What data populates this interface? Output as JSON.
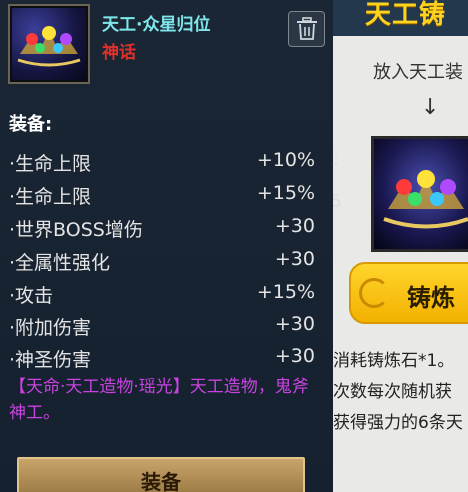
{
  "background_panel": {
    "title": "天工铸",
    "hint": "放入天工装",
    "arrow": "↓",
    "forge_button": "铸炼",
    "partial_mark_1": ":",
    "partial_mark_2": "5",
    "info_lines": [
      "消耗铸炼石*1。",
      "次数每次随机获",
      "获得强力的6条天"
    ]
  },
  "tooltip": {
    "item_name": "天工·众星归位",
    "rarity": "神话",
    "section_label": "装备:",
    "stats": [
      {
        "name": "·生命上限",
        "value": "+10%"
      },
      {
        "name": "·生命上限",
        "value": "+15%"
      },
      {
        "name": "·世界BOSS增伤",
        "value": "+30"
      },
      {
        "name": "·全属性强化",
        "value": "+30"
      },
      {
        "name": "·攻击",
        "value": "+15%"
      },
      {
        "name": "·附加伤害",
        "value": "+30"
      },
      {
        "name": "·神圣伤害",
        "value": "+30"
      }
    ],
    "description": "【天命·天工造物·瑶光】天工造物，鬼斧神工。",
    "equip_button": "装备"
  },
  "colors": {
    "item_name": "#7fe6ec",
    "rarity_mythic": "#e0302b",
    "description": "#c943e0",
    "forge_button": "#ffd52c"
  },
  "icons": [
    "trash-icon",
    "crown-gem-icon"
  ]
}
